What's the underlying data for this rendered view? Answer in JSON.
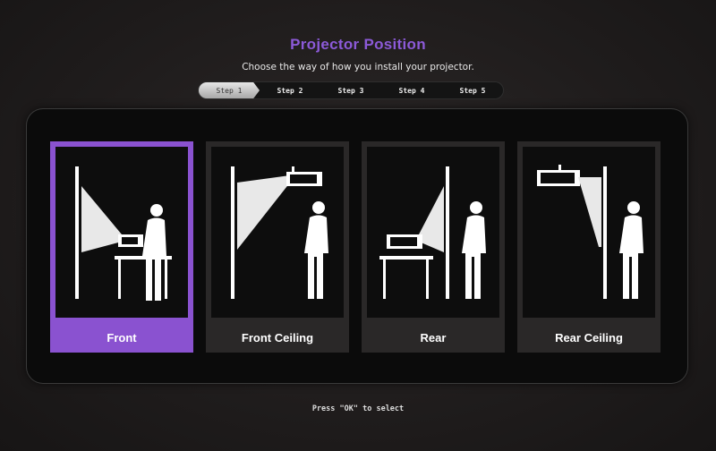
{
  "title": "Projector Position",
  "subtitle": "Choose the way of how you install your projector.",
  "steps": [
    "Step 1",
    "Step 2",
    "Step 3",
    "Step 4",
    "Step 5"
  ],
  "active_step": "Step 1",
  "options": [
    {
      "label": "Front",
      "selected": true,
      "icon": "front-projection-icon"
    },
    {
      "label": "Front Ceiling",
      "selected": false,
      "icon": "front-ceiling-projection-icon"
    },
    {
      "label": "Rear",
      "selected": false,
      "icon": "rear-projection-icon"
    },
    {
      "label": "Rear Ceiling",
      "selected": false,
      "icon": "rear-ceiling-projection-icon"
    }
  ],
  "footer": "Press \"OK\" to select",
  "colors": {
    "accent": "#8a52d0",
    "title": "#8c5ad8"
  }
}
